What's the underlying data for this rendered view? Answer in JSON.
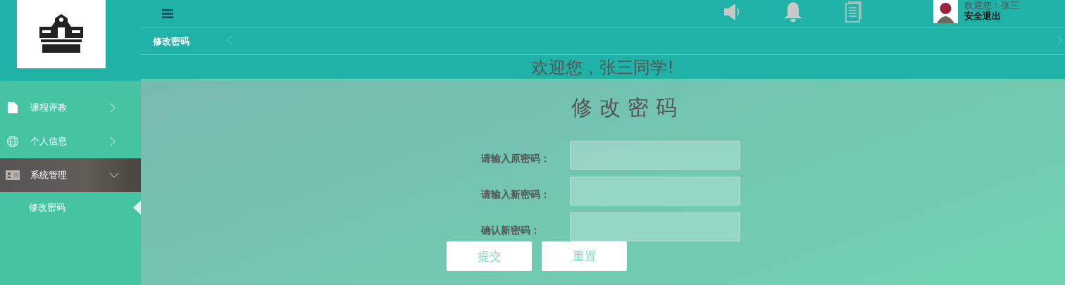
{
  "header": {
    "user": {
      "greeting": "欢迎您：张三",
      "logout": "安全退出"
    }
  },
  "tabs": [
    {
      "label": "修改密码",
      "selected": true
    }
  ],
  "welcome": "欢迎您，张三同学!",
  "sidebar": {
    "items": [
      {
        "label": "课程评教",
        "expanded": false,
        "selected": false
      },
      {
        "label": "个人信息",
        "expanded": false,
        "selected": false
      },
      {
        "label": "系统管理",
        "expanded": true,
        "selected": true,
        "children": [
          {
            "label": "修改密码",
            "selected": true
          }
        ]
      }
    ]
  },
  "form": {
    "title": "修改密码",
    "fields": [
      {
        "label": "请输入原密码："
      },
      {
        "label": "请输入新密码："
      },
      {
        "label": "确认新密码："
      }
    ],
    "buttons": [
      {
        "label": "提交"
      },
      {
        "label": "重置"
      }
    ]
  }
}
